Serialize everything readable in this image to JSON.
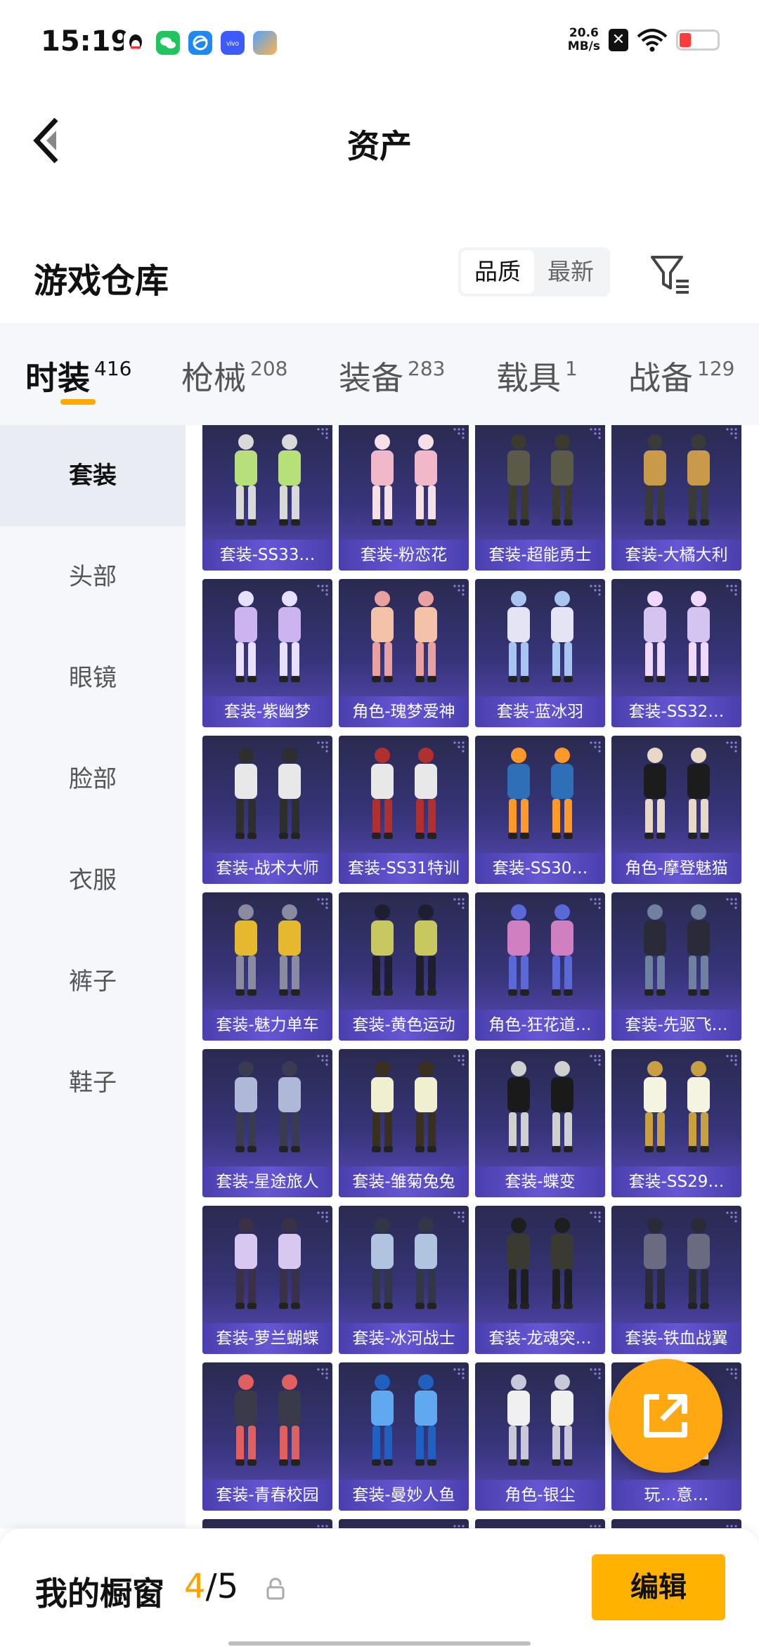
{
  "status_bar": {
    "time": "15:19",
    "net_speed_value": "20.6",
    "net_speed_unit": "MB/s"
  },
  "header": {
    "title": "资产"
  },
  "warehouse": {
    "title": "游戏仓库",
    "sort_options": [
      "品质",
      "最新"
    ]
  },
  "tabs": [
    {
      "label": "时装",
      "count": "416"
    },
    {
      "label": "枪械",
      "count": "208"
    },
    {
      "label": "装备",
      "count": "283"
    },
    {
      "label": "载具",
      "count": "1"
    },
    {
      "label": "战备",
      "count": "129"
    }
  ],
  "sidebar": {
    "items": [
      "套装",
      "头部",
      "眼镜",
      "脸部",
      "衣服",
      "裤子",
      "鞋子"
    ]
  },
  "grid": {
    "items": [
      "套装-SS33…",
      "套装-粉恋花",
      "套装-超能勇士",
      "套装-大橘大利",
      "套装-紫幽梦",
      "角色-瑰梦爱神",
      "套装-蓝冰羽",
      "套装-SS32…",
      "套装-战术大师",
      "套装-SS31特训",
      "套装-SS30…",
      "角色-摩登魅猫",
      "套装-魅力单车",
      "套装-黄色运动",
      "角色-狂花道…",
      "套装-先驱飞…",
      "套装-星途旅人",
      "套装-雏菊兔兔",
      "套装-蝶变",
      "套装-SS29…",
      "套装-萝兰蝴蝶",
      "套装-冰河战士",
      "套装-龙魂突…",
      "套装-铁血战翼",
      "套装-青春校园",
      "套装-曼妙人鱼",
      "角色-银尘",
      "玩…意…",
      "",
      "",
      "",
      ""
    ]
  },
  "showcase": {
    "label": "我的橱窗",
    "current": "4",
    "total": "/5",
    "edit_label": "编辑"
  },
  "colors": {
    "accent": "#ffa800",
    "card_bg": "#36357a",
    "label_bg": "#6656d4"
  }
}
